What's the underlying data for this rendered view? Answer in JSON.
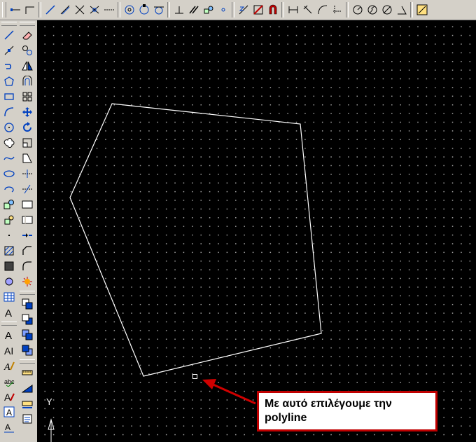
{
  "window": {
    "top_toolbar_icons": [
      "line-icon",
      "polyline-icon",
      "ray-icon",
      "construction-line-icon",
      "angle-icon",
      "intersect-icon",
      "extension-icon",
      "dash-icon",
      "center-icon",
      "quadrant-icon",
      "tangent-icon",
      "perpendicular-icon",
      "parallel-icon",
      "insert-icon",
      "node-icon",
      "nearest-icon",
      "snap-none-icon",
      "magnet-icon",
      "dim-linear-icon",
      "dim-aligned-icon",
      "dim-arc-icon",
      "dim-ordinate-icon",
      "dim-radius-icon",
      "dim-jogged-icon",
      "dim-diameter-icon",
      "dim-angular-icon",
      "quick-dim-icon"
    ],
    "left_col1_icons": [
      "line-icon",
      "construction-line-icon",
      "polyline-icon",
      "polygon-icon",
      "rectangle-icon",
      "arc-icon",
      "circle-icon",
      "revision-cloud-icon",
      "spline-icon",
      "ellipse-icon",
      "ellipse-arc-icon",
      "insert-block-icon",
      "make-block-icon",
      "point-icon",
      "hatch-icon",
      "gradient-icon",
      "region-icon",
      "table-icon",
      "multiline-text-icon",
      "text-icon",
      "text-edit-icon",
      "text-style-icon",
      "spell-check-icon",
      "find-text-icon",
      "scale-text-icon",
      "justify-text-icon"
    ],
    "left_col2_icons": [
      "erase-icon",
      "copy-icon",
      "mirror-icon",
      "offset-icon",
      "array-icon",
      "move-icon",
      "rotate-icon",
      "scale-icon",
      "stretch-icon",
      "trim-icon",
      "extend-icon",
      "break-at-point-icon",
      "break-icon",
      "join-icon",
      "chamfer-icon",
      "fillet-icon",
      "explode-icon",
      "draworder-front-icon",
      "draworder-back-icon",
      "draworder-above-icon",
      "draworder-under-icon",
      "dim-style-icon",
      "dim-update-icon",
      "dim-override-icon",
      "dim-edit-icon"
    ]
  },
  "drawing": {
    "ucs_label": "Y",
    "shape": "pentagon polyline"
  },
  "callout": {
    "text_line1": "Με αυτό επιλέγουμε την",
    "text_line2": "polyline",
    "border_color": "#c00000",
    "arrow_color": "#d00000"
  }
}
